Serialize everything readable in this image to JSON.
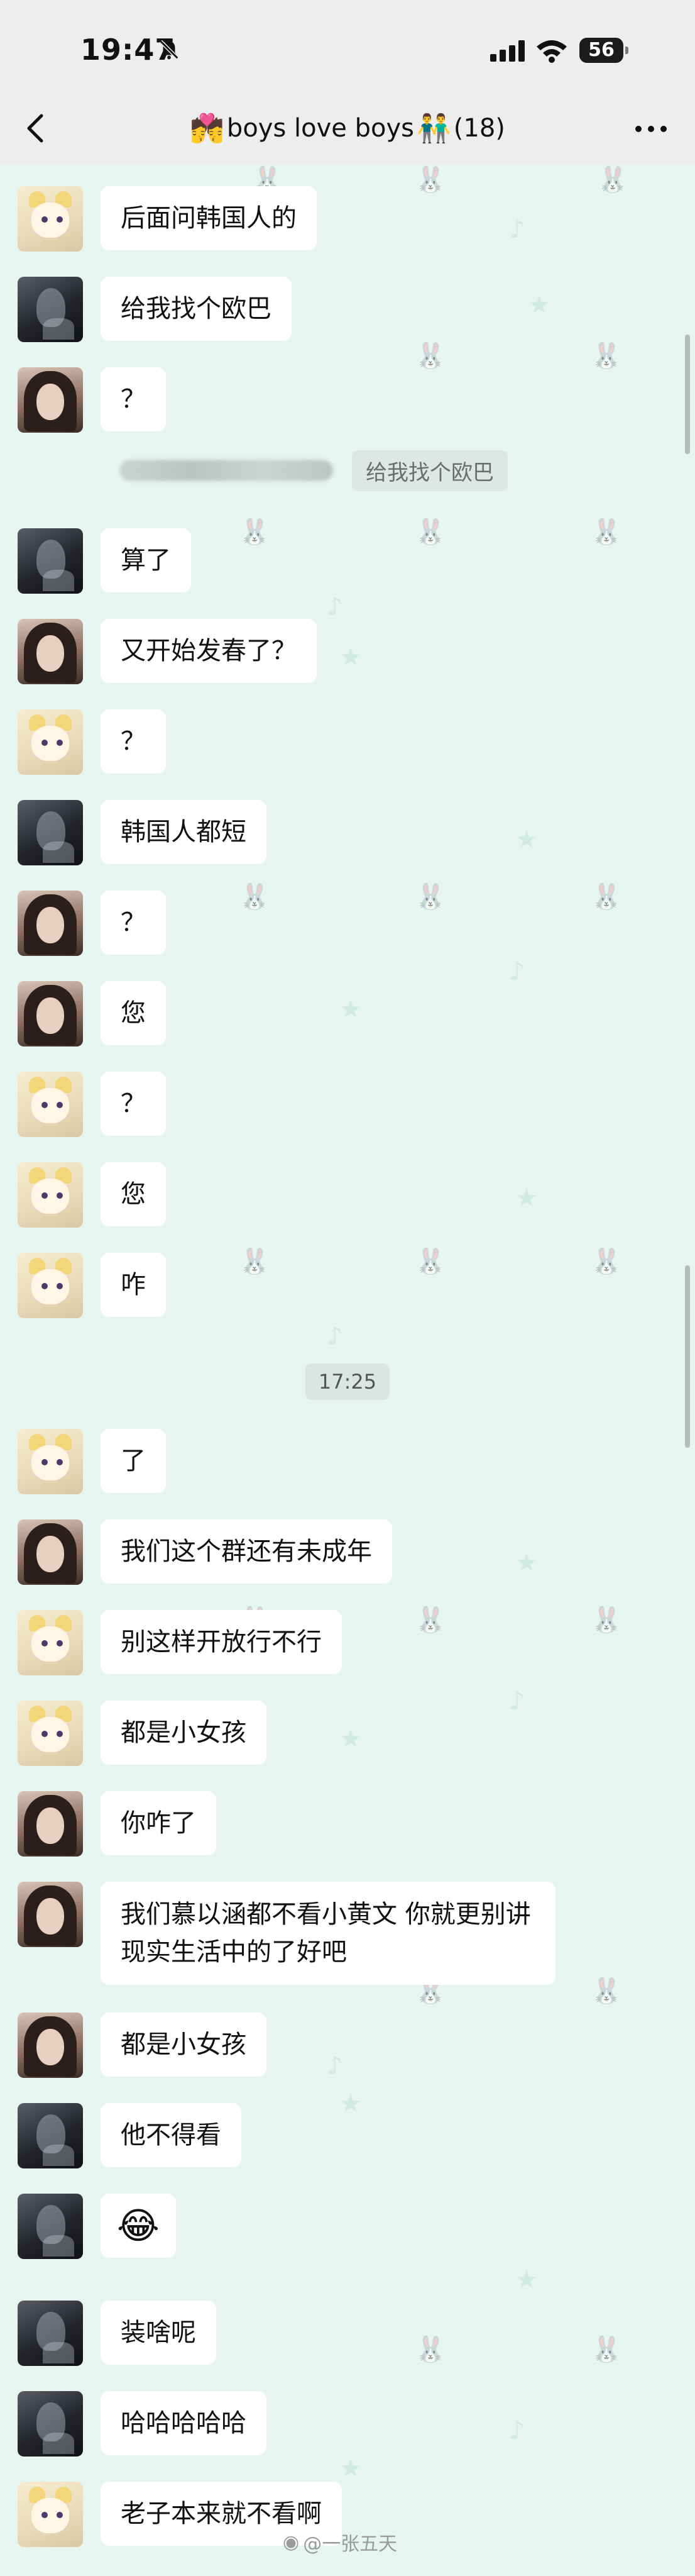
{
  "status": {
    "time": "19:47",
    "battery": "56"
  },
  "header": {
    "title_emoji": "💏",
    "title_text": "boys love boys",
    "title_emoji2": "👬",
    "member_count": "(18)"
  },
  "chat": {
    "messages": [
      {
        "text": "后面问韩国人的"
      },
      {
        "text": "给我找个欧巴"
      },
      {
        "text": "？"
      },
      {
        "text": "给我找个欧巴"
      },
      {
        "text": "算了"
      },
      {
        "text": "又开始发春了？"
      },
      {
        "text": "？"
      },
      {
        "text": "韩国人都短"
      },
      {
        "text": "？"
      },
      {
        "text": "您"
      },
      {
        "text": "？"
      },
      {
        "text": "您"
      },
      {
        "text": "咋"
      },
      {
        "text": "17:25"
      },
      {
        "text": "了"
      },
      {
        "text": "我们这个群还有未成年"
      },
      {
        "text": "别这样开放行不行"
      },
      {
        "text": "都是小女孩"
      },
      {
        "text": "你咋了"
      },
      {
        "text": "我们慕以涵都不看小黄文 你就更别讲现实生活中的了好吧"
      },
      {
        "text": "都是小女孩"
      },
      {
        "text": "他不得看"
      },
      {
        "text": "😂"
      },
      {
        "text": "装啥呢"
      },
      {
        "text": "哈哈哈哈哈"
      },
      {
        "text": "老子本来就不看啊"
      }
    ]
  },
  "watermark": {
    "text": "@一张五天"
  }
}
